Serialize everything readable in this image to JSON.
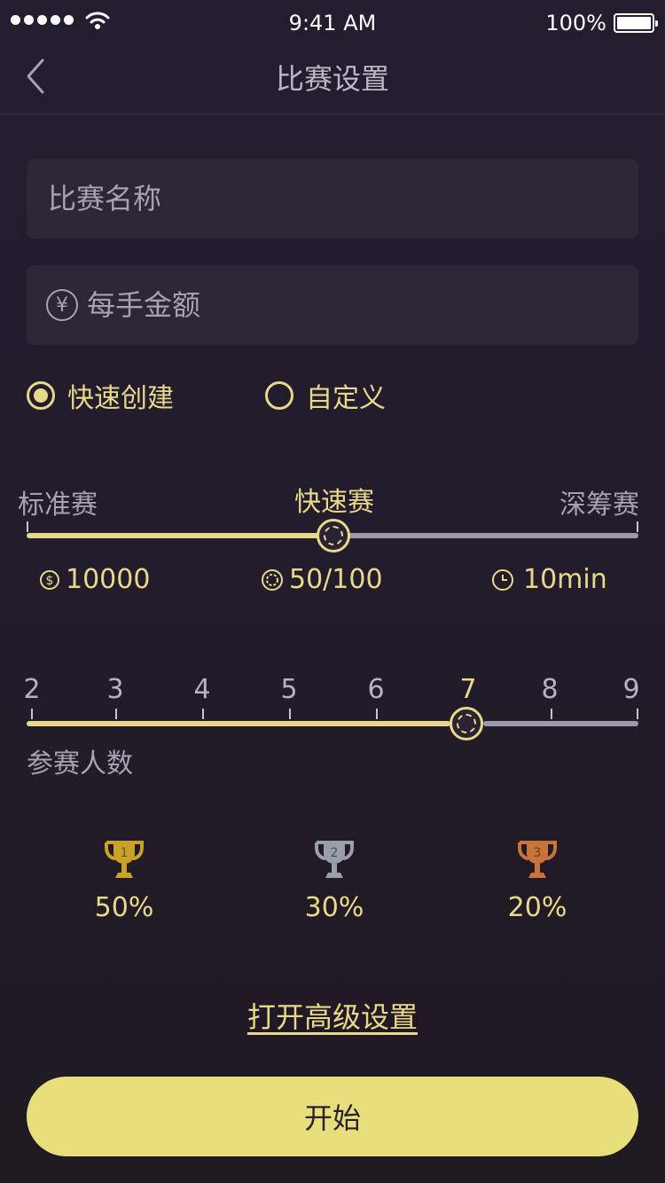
{
  "status_bar": {
    "time": "9:41 AM",
    "battery": "100%"
  },
  "nav": {
    "title": "比赛设置"
  },
  "form": {
    "match_name_placeholder": "比赛名称",
    "amount_placeholder": "每手金额",
    "yen_symbol": "¥"
  },
  "mode_options": [
    {
      "label": "快速创建",
      "selected": true
    },
    {
      "label": "自定义",
      "selected": false
    }
  ],
  "game_type": {
    "labels": [
      "标准赛",
      "快速赛",
      "深筹赛"
    ],
    "selected": "快速赛",
    "info": {
      "chips": "10000",
      "blinds": "50/100",
      "duration": "10min"
    }
  },
  "players": {
    "values": [
      "2",
      "3",
      "4",
      "5",
      "6",
      "7",
      "8",
      "9"
    ],
    "selected": "7",
    "label": "参赛人数"
  },
  "prizes": [
    {
      "rank": "1",
      "percent": "50%",
      "color": "#c9a227"
    },
    {
      "rank": "2",
      "percent": "30%",
      "color": "#9aa0aa"
    },
    {
      "rank": "3",
      "percent": "20%",
      "color": "#c7753a"
    }
  ],
  "advanced_link": "打开高级设置",
  "start_button": "开始",
  "colors": {
    "accent": "#e8d98a",
    "button": "#e8df7c",
    "track_inactive": "#9d98aa"
  }
}
